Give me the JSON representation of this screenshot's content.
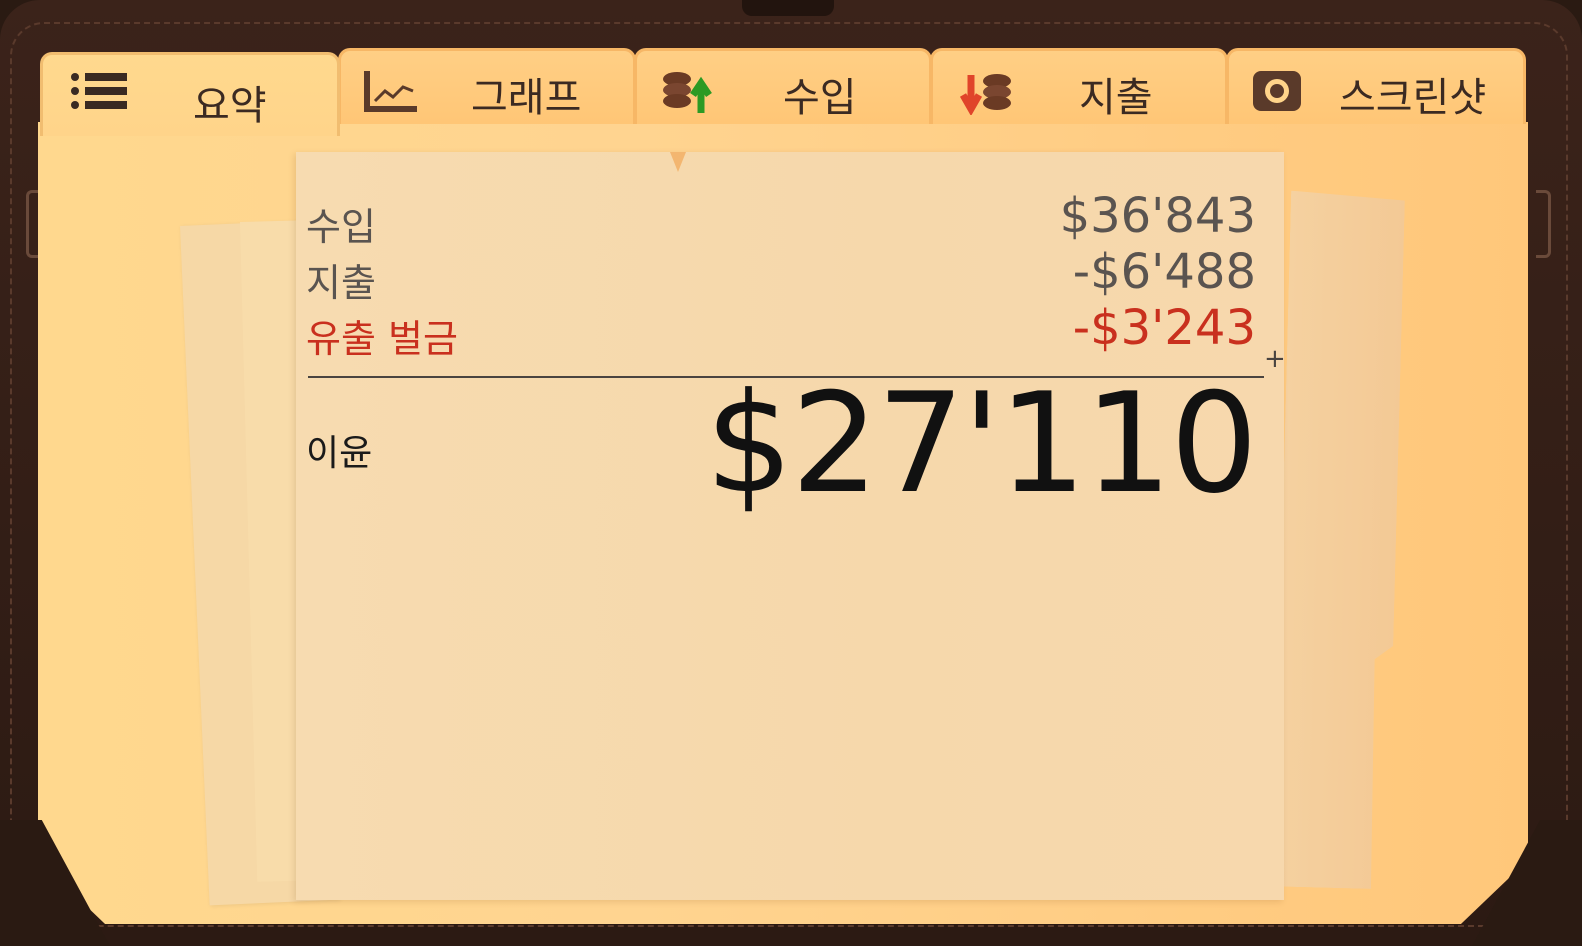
{
  "tabs": [
    {
      "label": "요약",
      "icon": "list-icon",
      "active": true
    },
    {
      "label": "그래프",
      "icon": "line-graph-icon",
      "active": false
    },
    {
      "label": "수입",
      "icon": "coins-up-icon",
      "active": false
    },
    {
      "label": "지출",
      "icon": "coins-down-icon",
      "active": false
    },
    {
      "label": "스크린샷",
      "icon": "camera-icon",
      "active": false
    }
  ],
  "summary": {
    "income_label": "수입",
    "income_value": "$36'843",
    "expenses_label": "지출",
    "expenses_value": "-$6'488",
    "penalty_label": "유출 벌금",
    "penalty_value": "-$3'243",
    "plus_sign": "+",
    "profit_label": "이윤",
    "profit_value": "$27'110"
  },
  "colors": {
    "penalty": "#c9301e",
    "text": "#5a5450",
    "panel": "#ffd48a"
  }
}
